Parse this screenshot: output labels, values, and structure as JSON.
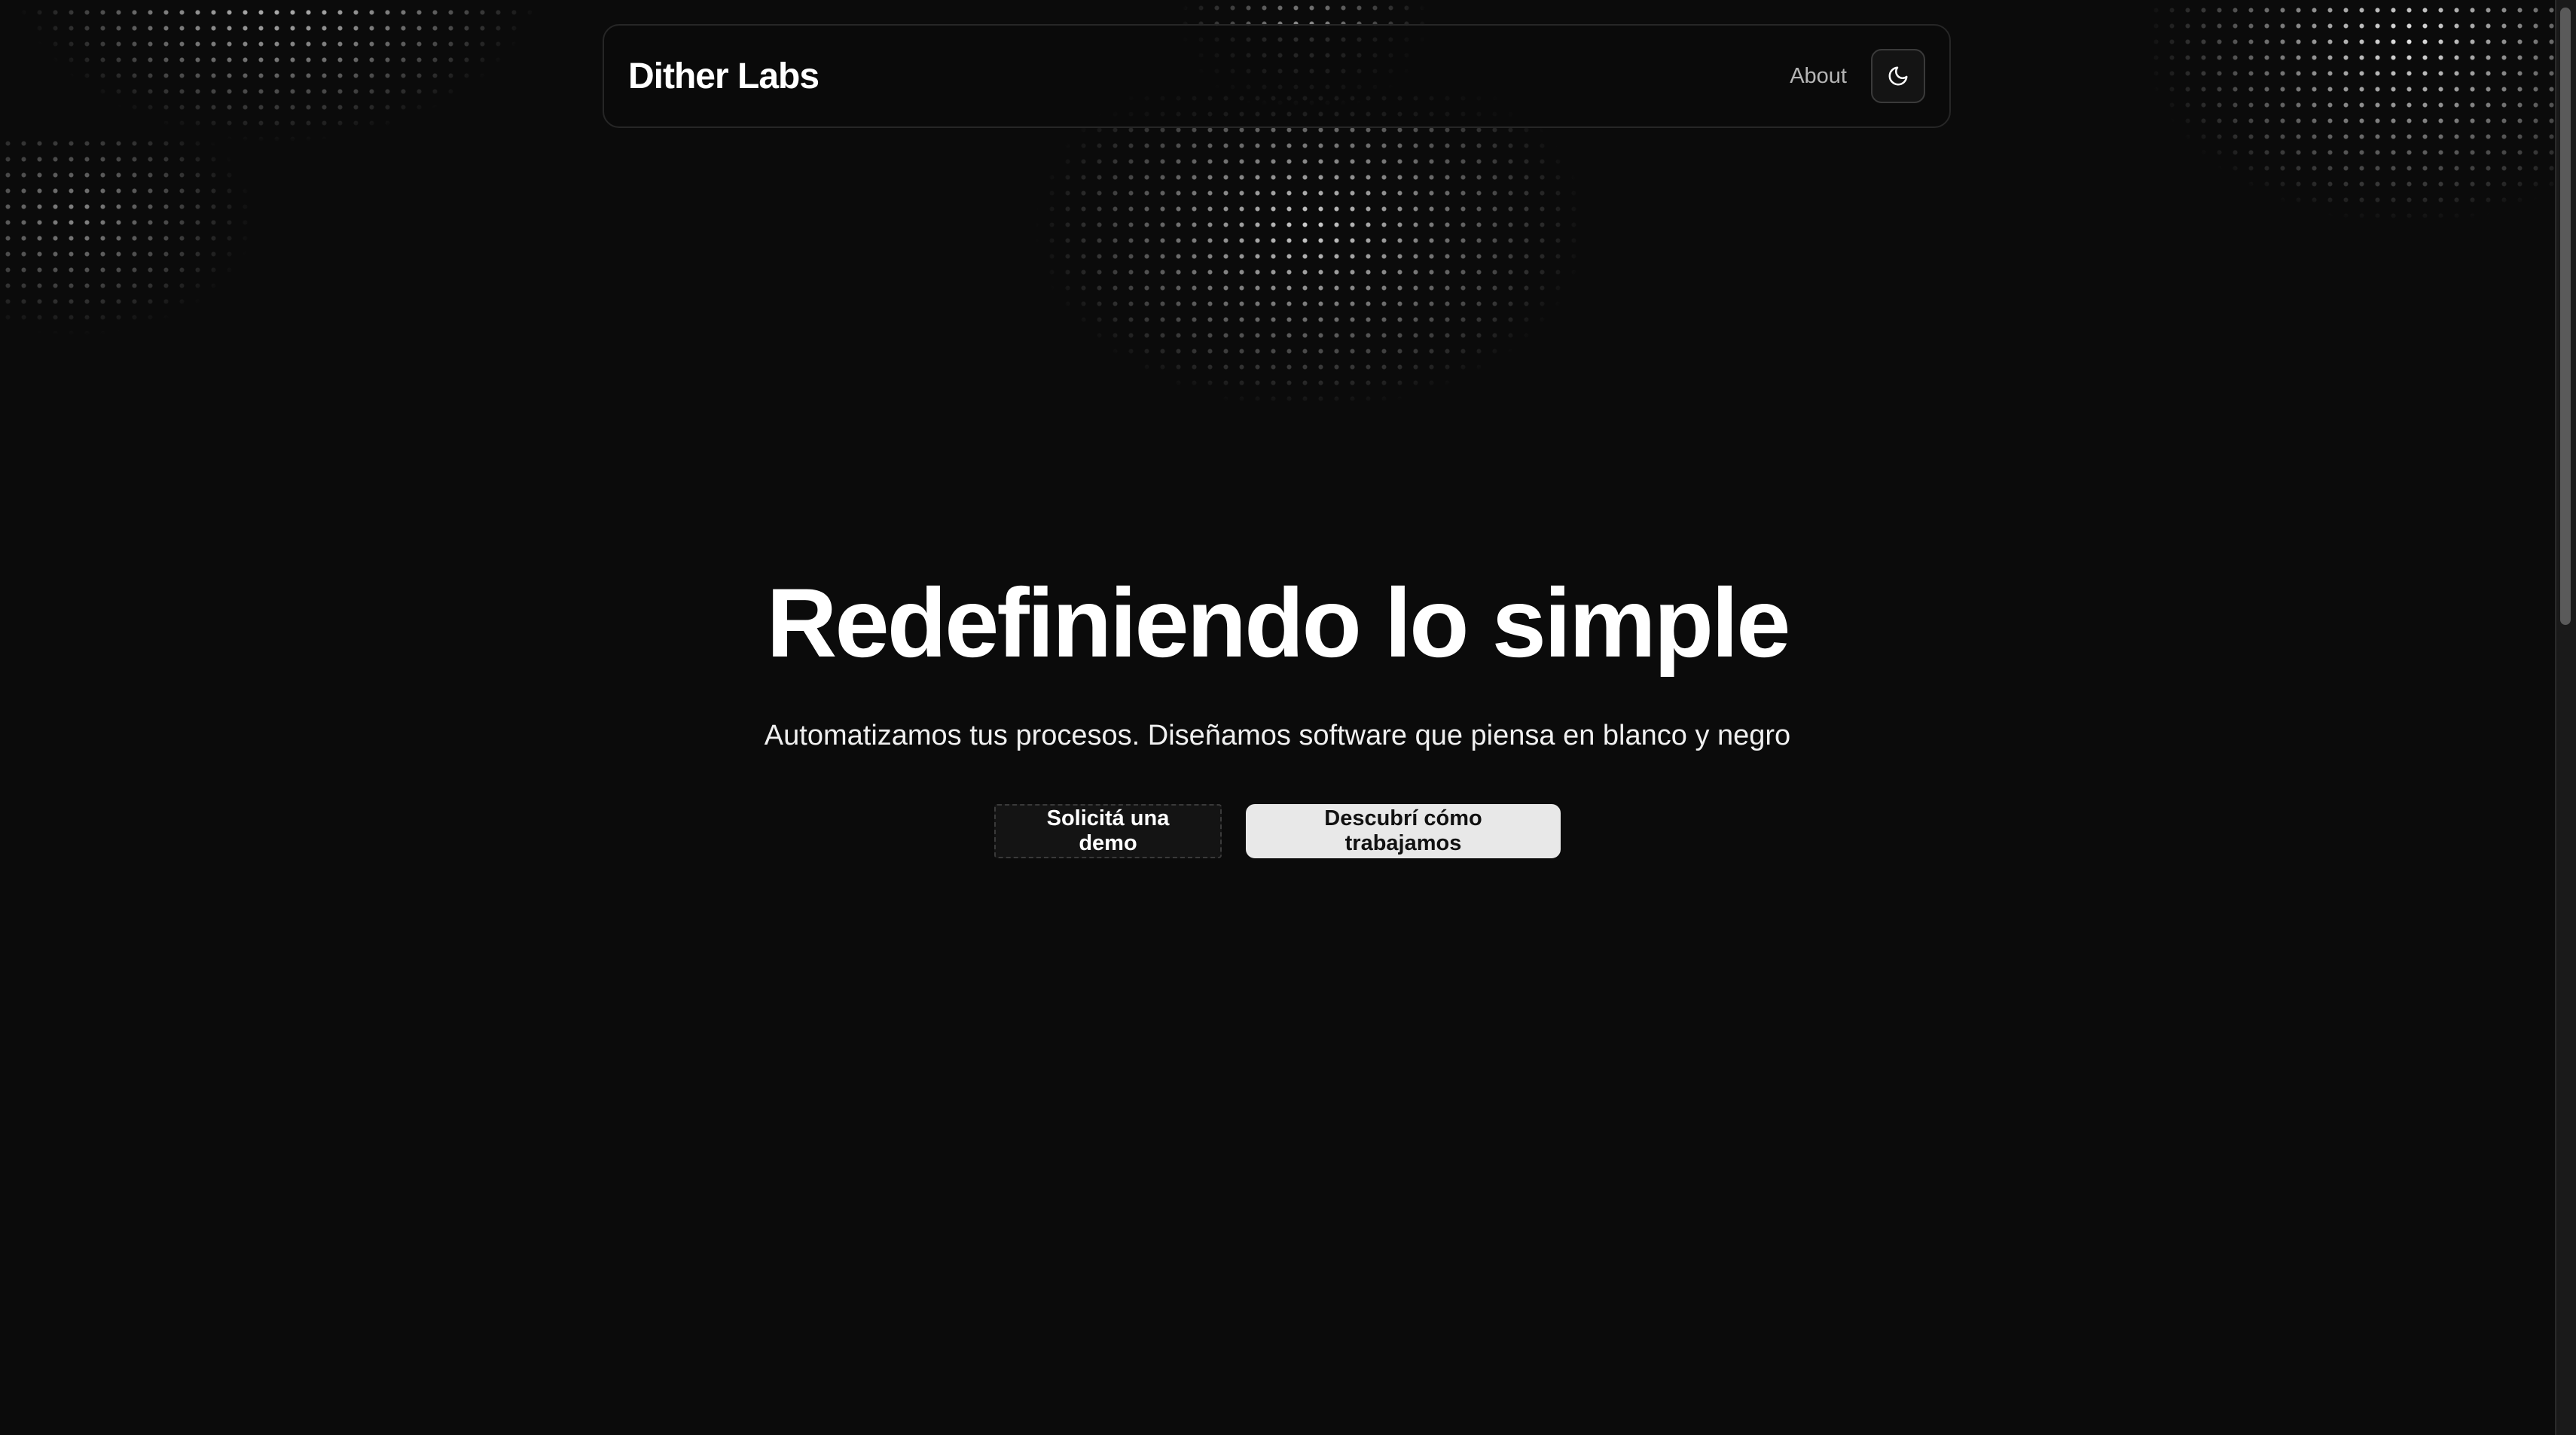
{
  "navbar": {
    "brand": "Dither Labs",
    "links": [
      {
        "label": "About"
      }
    ],
    "theme_toggle_icon": "moon-icon"
  },
  "hero": {
    "title": "Redefiniendo lo simple",
    "subtitle": "Automatizamos tus procesos. Diseñamos software que piensa en blanco y negro",
    "buttons": {
      "secondary_label": "Solicitá una demo",
      "primary_label": "Descubrí cómo trabajamos"
    }
  },
  "colors": {
    "background": "#0b0b0b",
    "text": "#ffffff",
    "muted_text": "#b5b5b5",
    "primary_button_bg": "#e8e8e8",
    "border": "#262626"
  }
}
